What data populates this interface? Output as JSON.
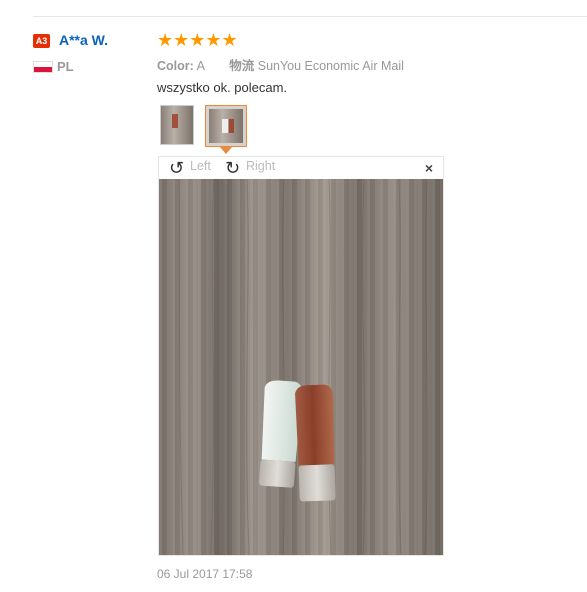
{
  "user": {
    "badge": "A3",
    "name": "A**a W.",
    "country": "PL"
  },
  "review": {
    "stars": "★★★★★",
    "color_label": "Color:",
    "color_value": "A",
    "shipping_label": "物流",
    "shipping_value": "SunYou Economic Air Mail",
    "text": "wszystko ok. polecam.",
    "date": "06 Jul 2017 17:58"
  },
  "viewer": {
    "left_label": "Left",
    "right_label": "Right",
    "close": "×"
  },
  "colors": {
    "name": "#0a62bd",
    "badge": "#e62e04",
    "stars": "#ff9900",
    "active_thumb": "#e8893e"
  }
}
